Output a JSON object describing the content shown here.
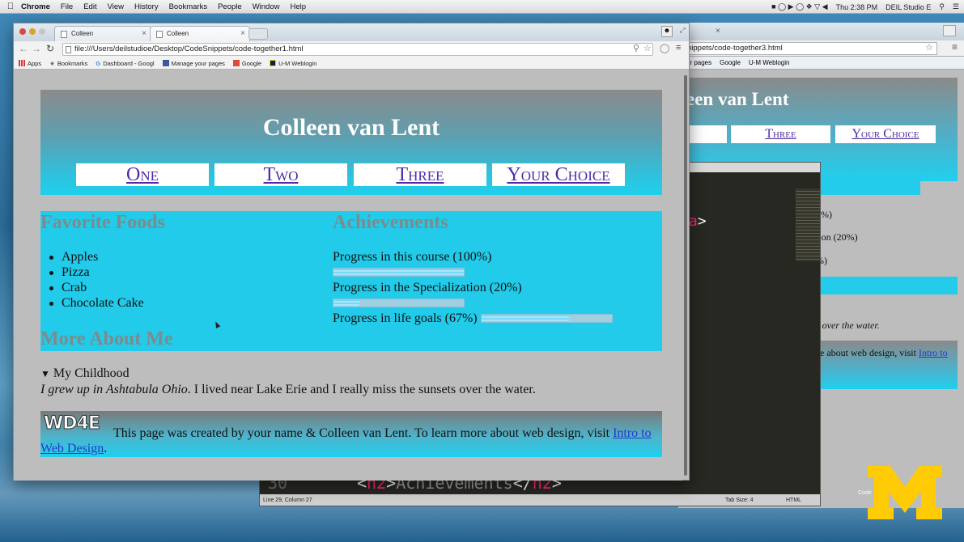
{
  "menubar": {
    "items": [
      "Chrome",
      "File",
      "Edit",
      "View",
      "History",
      "Bookmarks",
      "People",
      "Window",
      "Help"
    ],
    "clock": "Thu 2:38 PM",
    "user": "DEIL Studio E"
  },
  "back_window": {
    "url": "nippets/code-together3.html",
    "bookmarks": [
      "ur pages",
      "Google",
      "U-M Weblogin"
    ],
    "title": "een van Lent",
    "nav": [
      "",
      "Three",
      "Your Choice"
    ],
    "fragments": [
      "0%)",
      "tion (20%)",
      "%)"
    ],
    "italic_fragment": "s over the water.",
    "footer_fragment": "ore about web design, visit",
    "footer_link": "Intro to"
  },
  "editor": {
    "line_number": "30",
    "code_open": "<",
    "code_tag": "h2",
    "code_close_open": ">",
    "code_text": "Achievements",
    "code_end": "</",
    "code_tag2": "h2",
    "code_end_close": ">",
    "fragment_tag": "a",
    "status_position": "Line 29, Column 27",
    "tab_size": "Tab Size: 4",
    "syntax": "HTML"
  },
  "browser": {
    "tabs": [
      {
        "label": "Colleen"
      },
      {
        "label": "Colleen"
      }
    ],
    "url": "file:///Users/deilstudioe/Desktop/CodeSnippets/code-together1.html",
    "bookmarks": [
      "Apps",
      "Bookmarks",
      "Dashboard - Googl",
      "Manage your pages",
      "Google",
      "U-M Weblogin"
    ]
  },
  "page": {
    "title": "Colleen van Lent",
    "nav": [
      "One",
      "Two",
      "Three",
      "Your Choice"
    ],
    "favorite_foods_heading": "Favorite Foods",
    "foods": [
      "Apples",
      "Pizza",
      "Crab",
      "Chocolate Cake"
    ],
    "more_about_heading": "More About Me",
    "achievements_heading": "Achievements",
    "achievements": [
      {
        "label": "Progress in this course (100%)",
        "progress": 1.0
      },
      {
        "label": "Progress in the Specialization (20%)",
        "progress": 0.2
      },
      {
        "label": "Progress in life goals (67%)",
        "progress": 0.67
      }
    ],
    "details_summary": "My Childhood",
    "details_text_1": "I grew up in Ashtabula Ohio",
    "details_text_2": ". I lived near Lake Erie and I really miss the sunsets over the water",
    "details_text_3": ".",
    "footer_logo": "WD4E",
    "footer_text": "This page was created by your name & Colleen van Lent. To learn more about web design, visit ",
    "footer_link_part1": "Intro to",
    "footer_link_part2": "Web Design",
    "footer_end": "."
  },
  "watermark": {
    "code_by": "Code"
  },
  "colors": {
    "cyan": "#22cbe9",
    "nav_link": "#4f2aa8",
    "heading_gray": "#7c8b8d",
    "michigan_maize": "#ffcb05"
  }
}
